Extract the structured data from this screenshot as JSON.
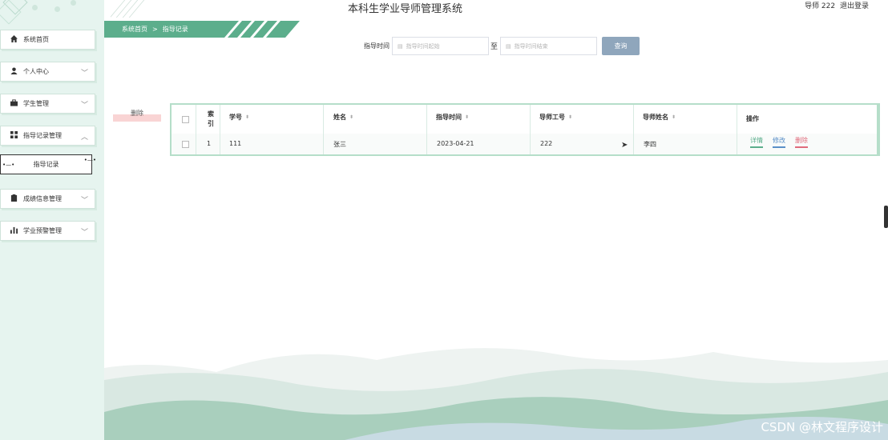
{
  "app": {
    "title": "本科生学业导师管理系统",
    "user_label": "导师 222",
    "logout_label": "退出登录"
  },
  "sidebar": {
    "items": [
      {
        "label": "系统首页",
        "icon": "home-icon",
        "has_chevron": false
      },
      {
        "label": "个人中心",
        "icon": "user-icon",
        "has_chevron": true,
        "chevron": "﹀"
      },
      {
        "label": "学生管理",
        "icon": "briefcase-icon",
        "has_chevron": true,
        "chevron": "﹀"
      },
      {
        "label": "指导记录管理",
        "icon": "grid-icon",
        "has_chevron": true,
        "chevron": "︿"
      },
      {
        "label": "成绩信息管理",
        "icon": "clipboard-icon",
        "has_chevron": true,
        "chevron": "﹀"
      },
      {
        "label": "学业预警管理",
        "icon": "bar-chart-icon",
        "has_chevron": true,
        "chevron": "﹀"
      }
    ],
    "subitem": {
      "label": "指导记录"
    }
  },
  "breadcrumb": {
    "home": "系统首页",
    "separator": ">",
    "current": "指导记录"
  },
  "search": {
    "label": "指导时间",
    "start_placeholder": "指导时间起始",
    "to_label": "至",
    "end_placeholder": "指导时间结束",
    "button_label": "查询"
  },
  "actions": {
    "delete_label": "删除"
  },
  "table": {
    "headers": {
      "index": "索引",
      "student_id": "学号",
      "name": "姓名",
      "time": "指导时间",
      "tutor_id": "导师工号",
      "tutor_name": "导师姓名",
      "ops": "操作"
    },
    "rows": [
      {
        "index": "1",
        "student_id": "111",
        "name": "张三",
        "time": "2023-04-21",
        "tutor_id": "222",
        "tutor_name": "李四"
      }
    ],
    "ops": {
      "detail": "详情",
      "edit": "修改",
      "delete": "删除"
    }
  },
  "watermark": "CSDN @林文程序设计",
  "colors": {
    "accent_green": "#5cae8c",
    "sidebar_bg": "#e6f4ef",
    "search_button": "#8fa6bc",
    "op_detail": "#5cae8c",
    "op_edit": "#5a8fc7",
    "op_delete": "#e06b7c"
  }
}
